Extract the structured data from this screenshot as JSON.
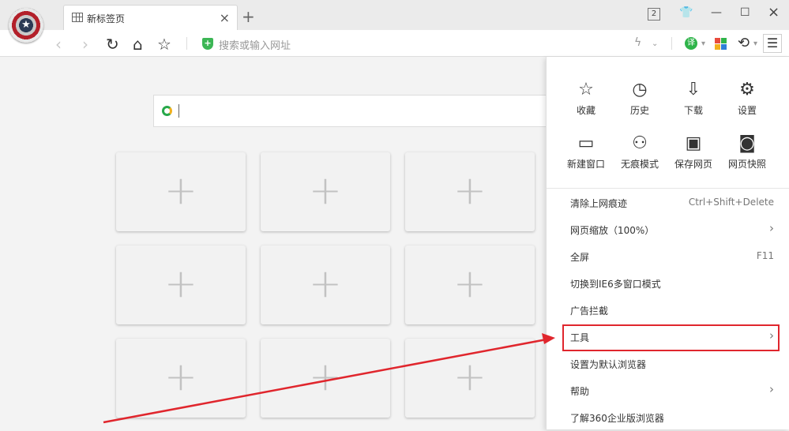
{
  "tab": {
    "title": "新标签页",
    "close": "×",
    "new": "+"
  },
  "window": {
    "count": "2",
    "skin": "👕",
    "minimize": "—",
    "maximize": "☐",
    "close": "×"
  },
  "toolbar": {
    "back": "‹",
    "forward": "›",
    "refresh": "↻",
    "home": "⌂",
    "favorite": "☆",
    "address_placeholder": "搜索或输入网址",
    "translate": "译",
    "undo": "⟲",
    "menu": "☰"
  },
  "quick": [
    {
      "label": "收藏",
      "icon": "star-icon",
      "glyph": "☆"
    },
    {
      "label": "历史",
      "icon": "clock-icon",
      "glyph": "◷"
    },
    {
      "label": "下载",
      "icon": "download-icon",
      "glyph": "⇩"
    },
    {
      "label": "设置",
      "icon": "gear-icon",
      "glyph": "⚙"
    },
    {
      "label": "新建窗口",
      "icon": "window-icon",
      "glyph": "▭"
    },
    {
      "label": "无痕模式",
      "icon": "incognito-icon",
      "glyph": "⚇"
    },
    {
      "label": "保存网页",
      "icon": "save-icon",
      "glyph": "▣"
    },
    {
      "label": "网页快照",
      "icon": "camera-icon",
      "glyph": "◙"
    }
  ],
  "menu": [
    {
      "label": "清除上网痕迹",
      "shortcut": "Ctrl+Shift+Delete"
    },
    {
      "label": "网页缩放（100%）",
      "arrow": "›"
    },
    {
      "label": "全屏",
      "shortcut": "F11"
    },
    {
      "label": "切换到IE6多窗口模式"
    },
    {
      "label": "广告拦截"
    },
    {
      "label": "工具",
      "arrow": "›"
    },
    {
      "label": "设置为默认浏览器"
    },
    {
      "label": "帮助",
      "arrow": "›"
    },
    {
      "label": "了解360企业版浏览器"
    }
  ],
  "tiles": [
    "+",
    "+",
    "+",
    "+",
    "+",
    "+",
    "+",
    "+",
    "+"
  ],
  "colors": {
    "highlight": "#e0262d",
    "accent_green": "#2fb44a"
  }
}
